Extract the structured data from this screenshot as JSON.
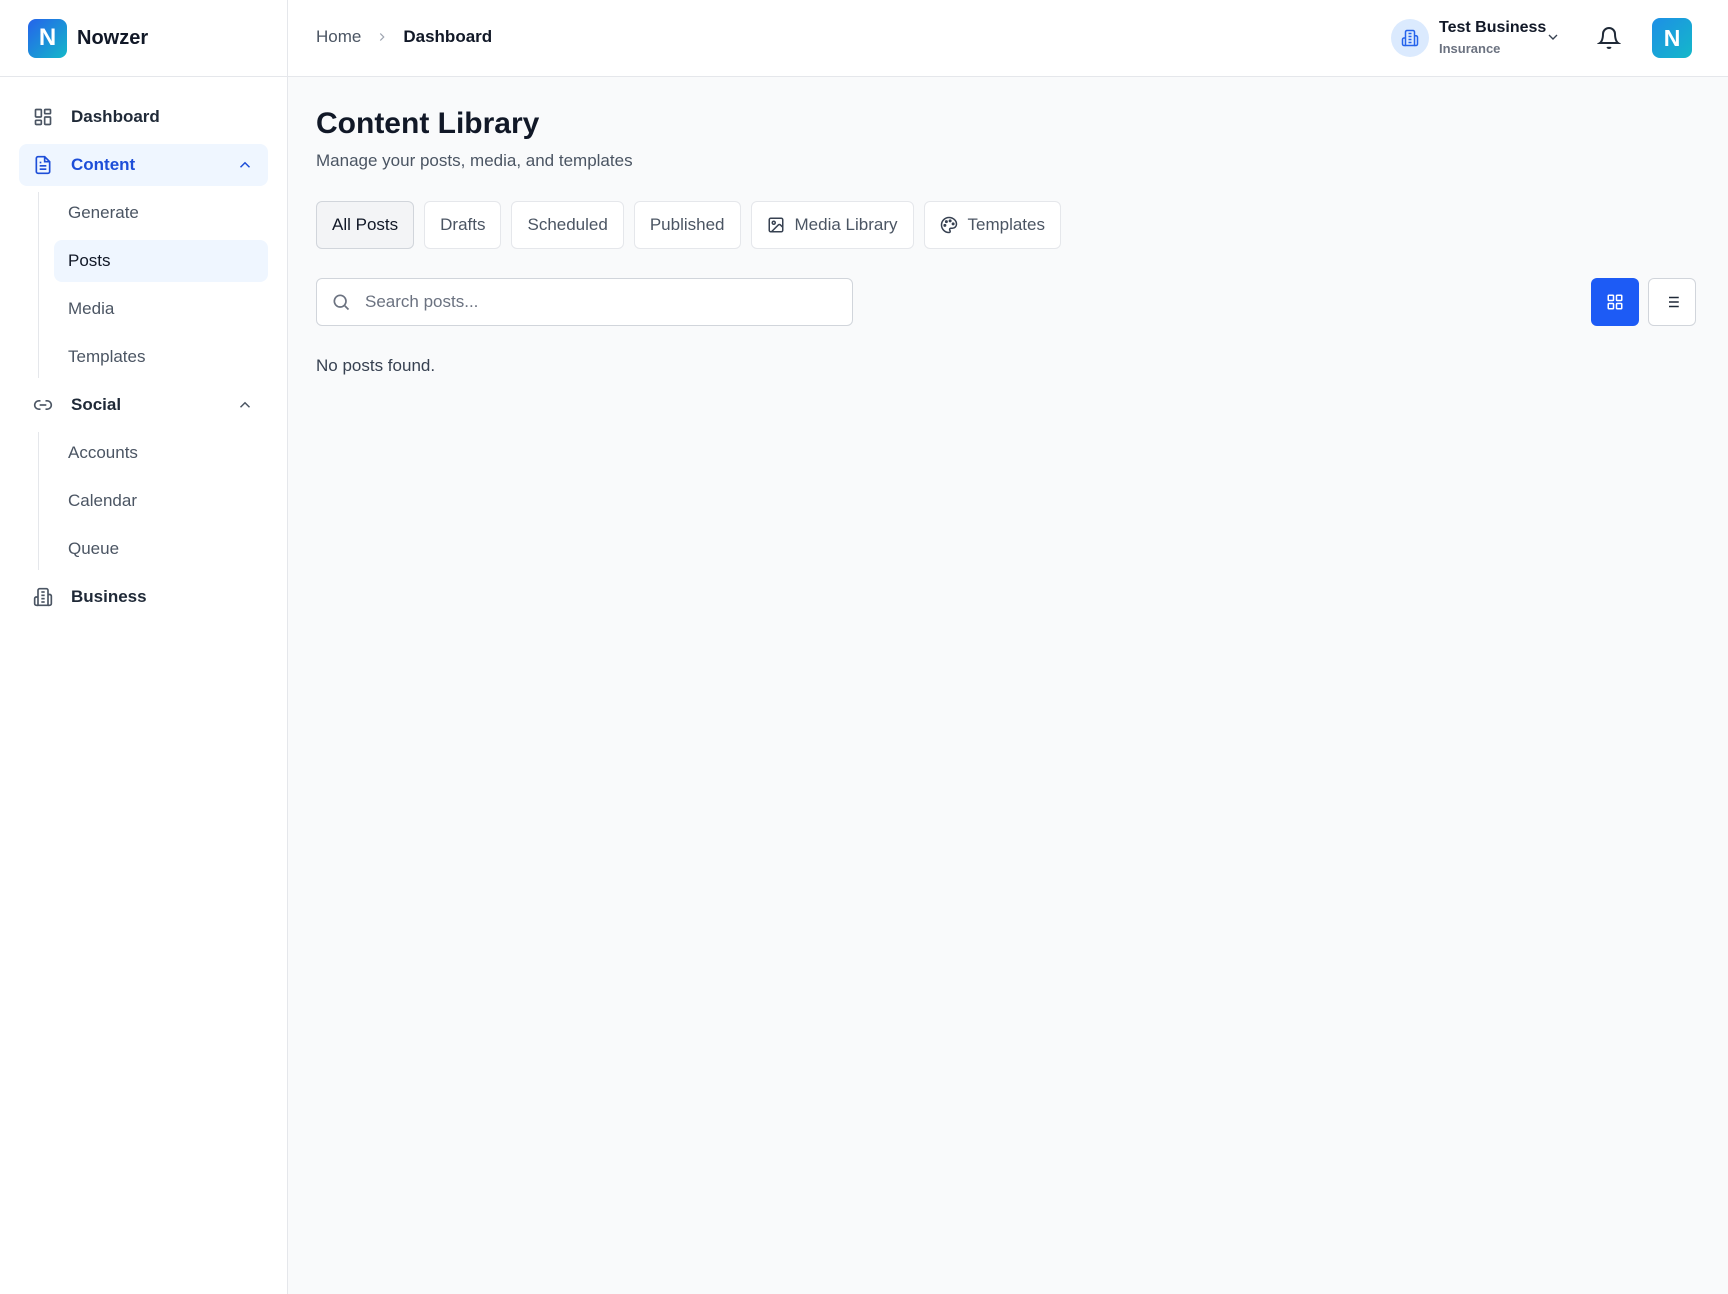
{
  "brand": {
    "logo_letter": "N",
    "name": "Nowzer"
  },
  "sidebar": {
    "dashboard": {
      "label": "Dashboard",
      "icon": "layout-grid-icon"
    },
    "content": {
      "label": "Content",
      "icon": "file-text-icon",
      "expanded": true,
      "items": [
        {
          "label": "Generate"
        },
        {
          "label": "Posts",
          "active": true
        },
        {
          "label": "Media"
        },
        {
          "label": "Templates"
        }
      ]
    },
    "social": {
      "label": "Social",
      "icon": "link-icon",
      "expanded": true,
      "items": [
        {
          "label": "Accounts"
        },
        {
          "label": "Calendar"
        },
        {
          "label": "Queue"
        }
      ]
    },
    "business": {
      "label": "Business",
      "icon": "building-icon"
    }
  },
  "header": {
    "breadcrumb": {
      "home": "Home",
      "current": "Dashboard"
    },
    "business_switcher": {
      "name": "Test Business",
      "category": "Insurance"
    },
    "avatar_letter": "N"
  },
  "main": {
    "title": "Content Library",
    "subtitle": "Manage your posts, media, and templates",
    "tabs": [
      {
        "label": "All Posts",
        "active": true
      },
      {
        "label": "Drafts"
      },
      {
        "label": "Scheduled"
      },
      {
        "label": "Published"
      },
      {
        "label": "Media Library",
        "icon": "image-icon"
      },
      {
        "label": "Templates",
        "icon": "palette-icon"
      }
    ],
    "search": {
      "placeholder": "Search posts...",
      "value": ""
    },
    "view_mode": "grid",
    "empty_message": "No posts found."
  },
  "colors": {
    "accent": "#1d5bf5",
    "active_bg": "#eff6ff",
    "active_text": "#1d4ed8"
  }
}
